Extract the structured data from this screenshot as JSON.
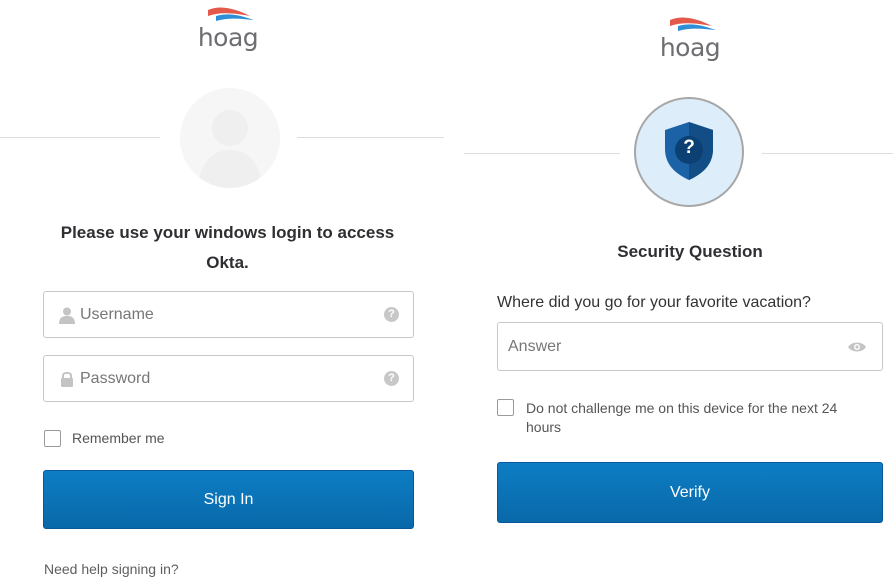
{
  "left": {
    "logo_text": "hoag",
    "heading": "Please use your windows login to access Okta.",
    "username": {
      "placeholder": "Username",
      "value": ""
    },
    "password": {
      "placeholder": "Password",
      "value": ""
    },
    "help_glyph": "?",
    "remember_label": "Remember me",
    "sign_in_label": "Sign In",
    "help_link": "Need help signing in?",
    "icons": [
      "user-icon",
      "lock-icon",
      "help-icon"
    ]
  },
  "right": {
    "logo_text": "hoag",
    "badge_glyph": "?",
    "heading": "Security Question",
    "question": "Where did you go for your favorite vacation?",
    "answer": {
      "placeholder": "Answer",
      "value": ""
    },
    "do_not_challenge_label": "Do not challenge me on this device for the next 24 hours",
    "verify_label": "Verify",
    "icons": [
      "shield-question-icon",
      "eye-icon"
    ]
  },
  "colors": {
    "primary_button": "#0b74b8",
    "logo_red": "#e35a4a",
    "logo_blue": "#2f8fd6",
    "badge_background": "#ddeefa",
    "shield": "#1b63a6"
  }
}
